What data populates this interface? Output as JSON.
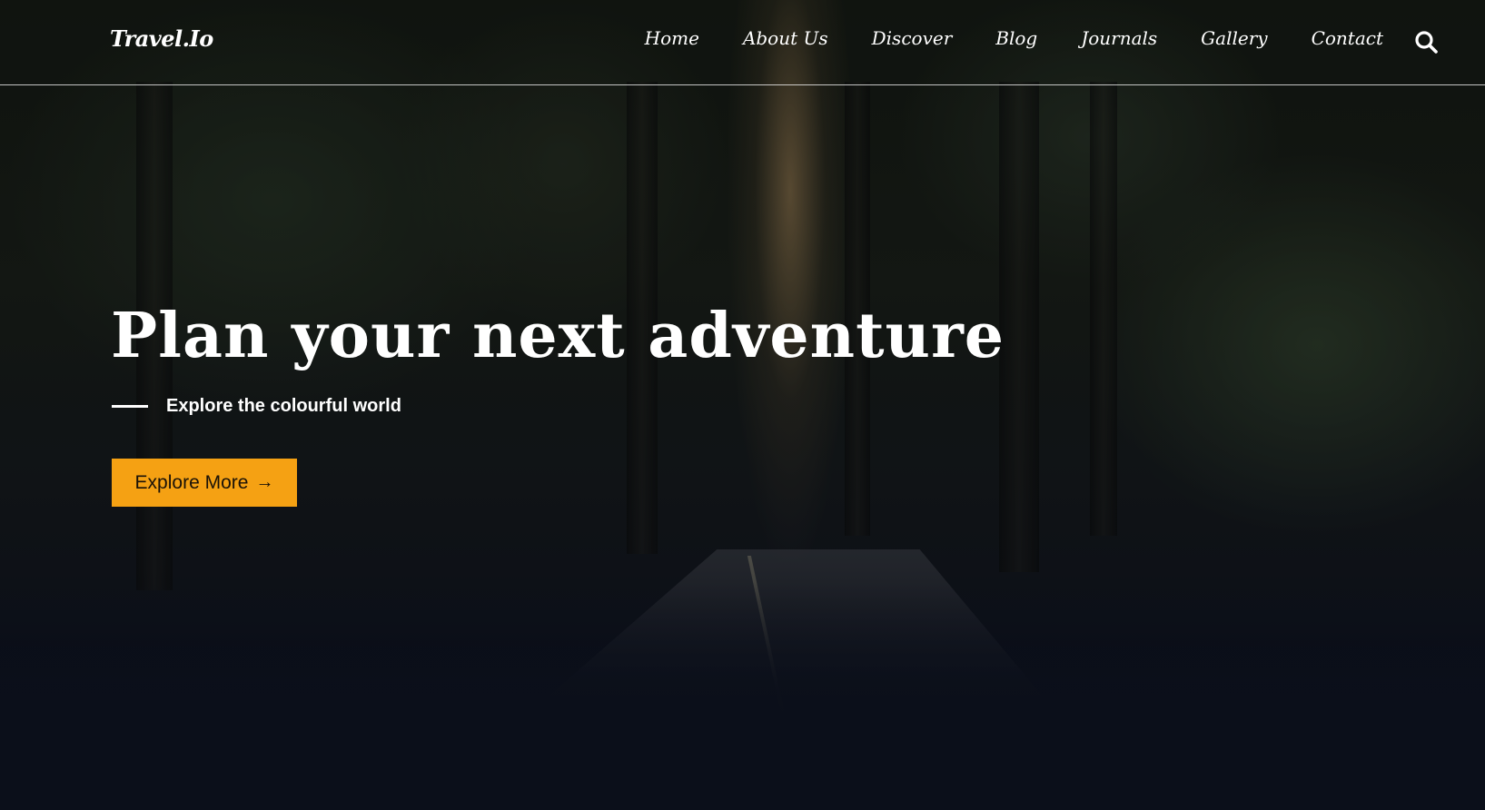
{
  "brand": {
    "logo_text": "Travel.Io"
  },
  "nav": {
    "items": [
      {
        "label": "Home"
      },
      {
        "label": "About Us"
      },
      {
        "label": "Discover"
      },
      {
        "label": "Blog"
      },
      {
        "label": "Journals"
      },
      {
        "label": "Gallery"
      },
      {
        "label": "Contact"
      }
    ],
    "search_icon": "search-icon"
  },
  "hero": {
    "headline": "Plan your next adventure",
    "tagline": "Explore the colourful world",
    "cta_label": "Explore More",
    "cta_icon": "arrow-right-icon"
  },
  "colors": {
    "accent": "#f5a113",
    "background": "#0b0f1a",
    "text": "#ffffff"
  }
}
